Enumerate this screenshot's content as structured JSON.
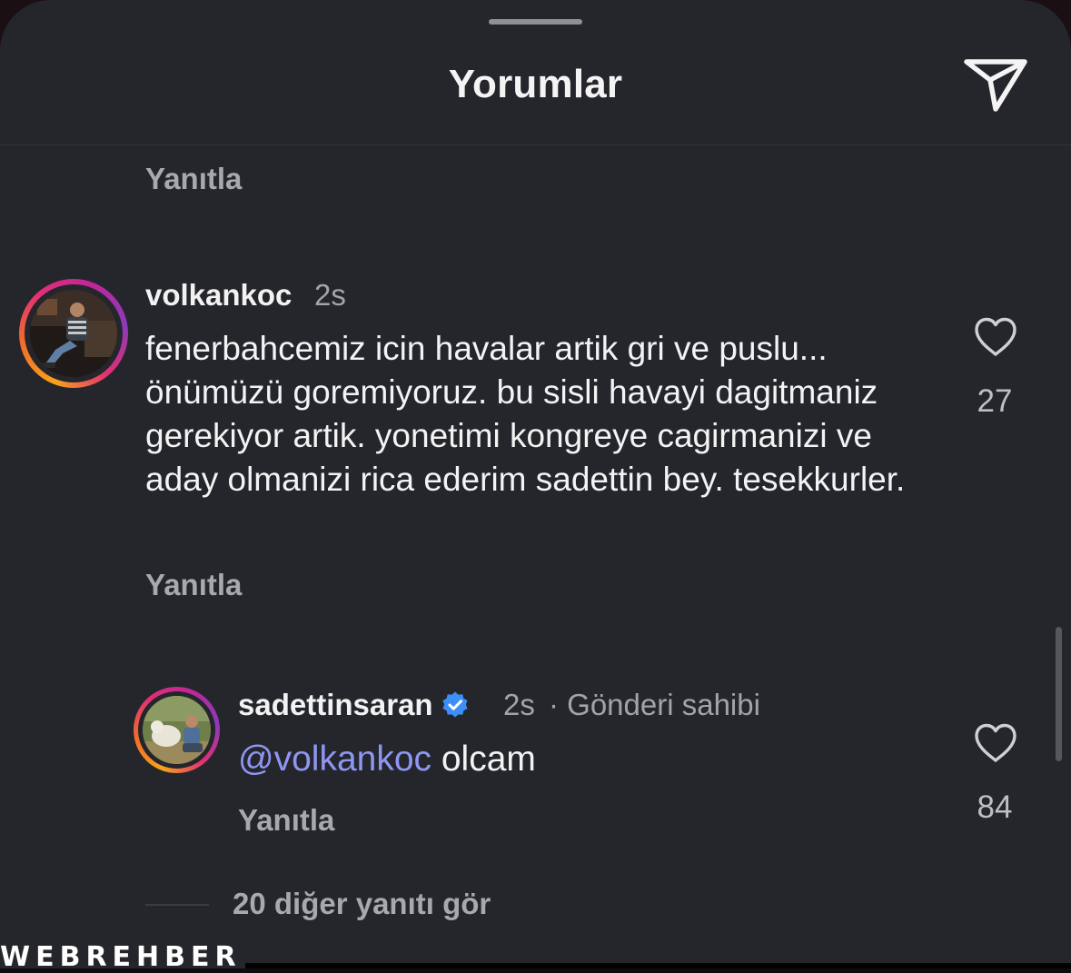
{
  "header": {
    "title": "Yorumlar",
    "share_icon": "paper-plane-icon"
  },
  "reply_label": "Yanıtla",
  "comments": [
    {
      "username": "volkankoc",
      "time": "2s",
      "text": "fenerbahcemiz icin havalar artik gri ve puslu... önümüzü goremiyoruz. bu sisli havayi dagitmaniz gerekiyor artik. yonetimi kongreye cagirmanizi ve aday olmanizi rica ederim sadettin bey. tesekkurler.",
      "likes": "27"
    }
  ],
  "reply": {
    "username": "sadettinsaran",
    "verified": true,
    "time": "2s",
    "owner_label": "· Gönderi sahibi",
    "mention": "@volkankoc",
    "text": "olcam",
    "likes": "84"
  },
  "more_replies": "20 diğer yanıtı gör",
  "watermark": "WEBREHBER",
  "colors": {
    "background": "#24262b",
    "mention": "#8f96f2",
    "verified": "#3b8ff6"
  }
}
